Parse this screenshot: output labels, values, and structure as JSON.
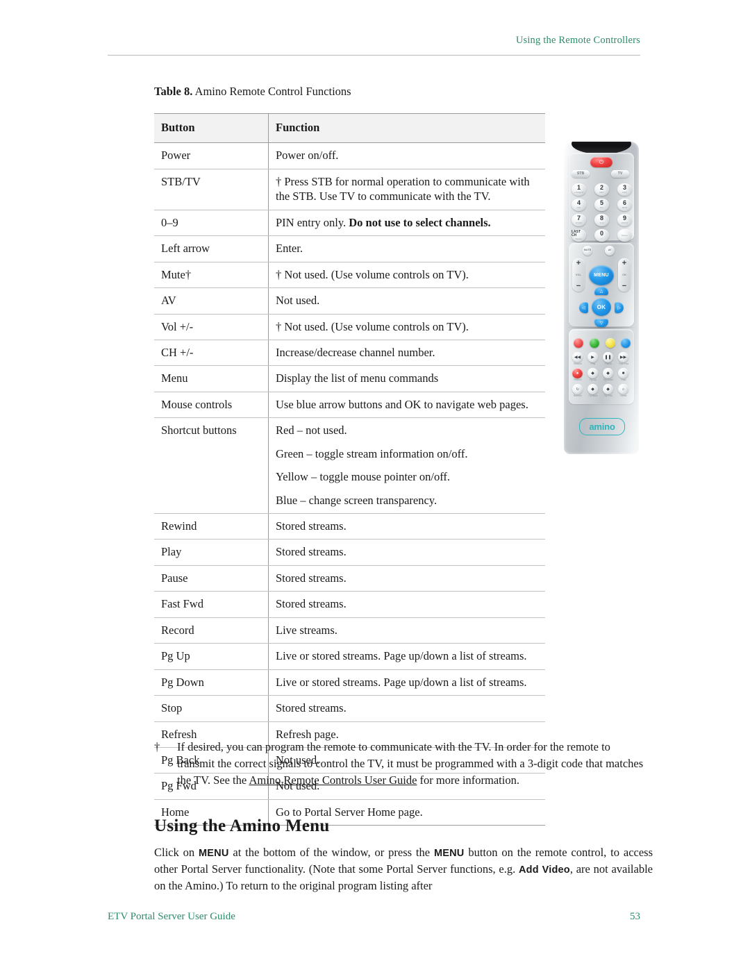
{
  "running_head": "Using the Remote Controllers",
  "table": {
    "caption_label": "Table 8.",
    "caption_text": "Amino Remote Control Functions",
    "headers": {
      "button": "Button",
      "function": "Function"
    },
    "rows": [
      {
        "button": "Power",
        "lines": [
          "Power on/off."
        ]
      },
      {
        "button": "STB/TV",
        "lines": [
          "† Press STB for normal operation to communicate with the STB. Use TV to communicate with the TV."
        ]
      },
      {
        "button": "0–9",
        "lines": [
          "PIN entry only. "
        ],
        "bold_tail": "Do not use to select channels."
      },
      {
        "button": "Left arrow",
        "lines": [
          "Enter."
        ]
      },
      {
        "button": "Mute†",
        "lines": [
          "† Not used. (Use volume controls on TV)."
        ]
      },
      {
        "button": "AV",
        "lines": [
          "Not used."
        ]
      },
      {
        "button": "Vol +/-",
        "lines": [
          "† Not used. (Use volume controls on TV)."
        ]
      },
      {
        "button": "CH +/-",
        "lines": [
          "Increase/decrease channel number."
        ]
      },
      {
        "button": "Menu",
        "lines": [
          "Display the list of menu commands"
        ]
      },
      {
        "button": "Mouse controls",
        "lines": [
          "Use blue arrow buttons and OK to navigate web pages."
        ]
      },
      {
        "button": "Shortcut buttons",
        "lines": [
          "Red – not used.",
          "Green – toggle stream information on/off.",
          "Yellow – toggle mouse pointer on/off.",
          "Blue – change screen transparency."
        ]
      },
      {
        "button": "Rewind",
        "lines": [
          "Stored streams."
        ]
      },
      {
        "button": "Play",
        "lines": [
          "Stored streams."
        ]
      },
      {
        "button": "Pause",
        "lines": [
          "Stored streams."
        ]
      },
      {
        "button": "Fast Fwd",
        "lines": [
          "Stored streams."
        ]
      },
      {
        "button": "Record",
        "lines": [
          "Live streams."
        ]
      },
      {
        "button": "Pg Up",
        "lines": [
          "Live or stored streams. Page up/down a list of streams."
        ]
      },
      {
        "button": "Pg Down",
        "lines": [
          "Live or stored streams. Page up/down a list of streams."
        ]
      },
      {
        "button": "Stop",
        "lines": [
          "Stored streams."
        ]
      },
      {
        "button": "Refresh",
        "lines": [
          "Refresh page."
        ]
      },
      {
        "button": "Pg Back",
        "lines": [
          "Not used."
        ]
      },
      {
        "button": "Pg Fwd",
        "lines": [
          "Not used."
        ]
      },
      {
        "button": "Home",
        "lines": [
          "Go to Portal Server Home page."
        ]
      }
    ]
  },
  "footnote": {
    "marker": "†",
    "part1": "If desired, you can program the remote to communicate with the TV. In order for the remote to transmit the correct signals to control the TV, it must be programmed with a 3-digit code that matches the TV. See the ",
    "link": "Amino Remote Controls User Guide",
    "part2": " for more information."
  },
  "section": {
    "title": "Using the Amino Menu",
    "p1": "Click on ",
    "menu1": "MENU",
    "p2": " at the bottom of the window, or press the ",
    "menu2": "MENU",
    "p3": " button on the remote control, to access other Portal Server functionality. (Note that some Portal Server functions, e.g. ",
    "addvideo": "Add Video",
    "p4": ", are not available on the Amino.) To return to the original program listing after"
  },
  "footer": {
    "left": "ETV Portal Server User Guide",
    "page": "53"
  },
  "remote": {
    "power": "⏻",
    "stb": "STB",
    "tv": "TV",
    "keys": [
      {
        "digit": "1",
        "sub": "+*&#@!%"
      },
      {
        "digit": "2",
        "sub": "ABC"
      },
      {
        "digit": "3",
        "sub": "DEF"
      },
      {
        "digit": "4",
        "sub": "GHI"
      },
      {
        "digit": "5",
        "sub": "JKL"
      },
      {
        "digit": "6",
        "sub": "MNO"
      },
      {
        "digit": "7",
        "sub": "PQRS"
      },
      {
        "digit": "8",
        "sub": "TUV"
      },
      {
        "digit": "9",
        "sub": "WXYZ"
      },
      {
        "digit": "LAST CH",
        "sub": "Delete"
      },
      {
        "digit": "0",
        "sub": "—"
      },
      {
        "digit": "",
        "sub": "Space"
      }
    ],
    "mute": "MUTE",
    "av": "AV",
    "vol_label": "VOL",
    "ch_label": "CH",
    "plus": "+",
    "minus": "−",
    "menu": "MENU",
    "ok": "OK",
    "arrow_up": "△",
    "arrow_down": "▽",
    "arrow_left": "◁",
    "arrow_right": "▷",
    "colors": [
      "red",
      "green",
      "yellow",
      "blue"
    ],
    "transport": [
      {
        "glyph": "◀◀",
        "label": "Rewind"
      },
      {
        "glyph": "▶",
        "label": "Play"
      },
      {
        "glyph": "❚❚",
        "label": "Pause"
      },
      {
        "glyph": "▶▶",
        "label": "Fast Fwd"
      },
      {
        "glyph": "●",
        "label": "Record"
      },
      {
        "glyph": "◆",
        "label": "Pg Up"
      },
      {
        "glyph": "◆",
        "label": "Pg Down"
      },
      {
        "glyph": "■",
        "label": "Stop"
      },
      {
        "glyph": "↻",
        "label": "Refresh"
      },
      {
        "glyph": "◆",
        "label": "Pg Back"
      },
      {
        "glyph": "◆",
        "label": "Pg Fwd"
      },
      {
        "glyph": "⌂",
        "label": "Home"
      }
    ],
    "brand": "amino"
  },
  "colors": {
    "accent_green": "#2e8b67",
    "remote_blue": "#2196e8",
    "brand_teal": "#2bb6bd"
  }
}
